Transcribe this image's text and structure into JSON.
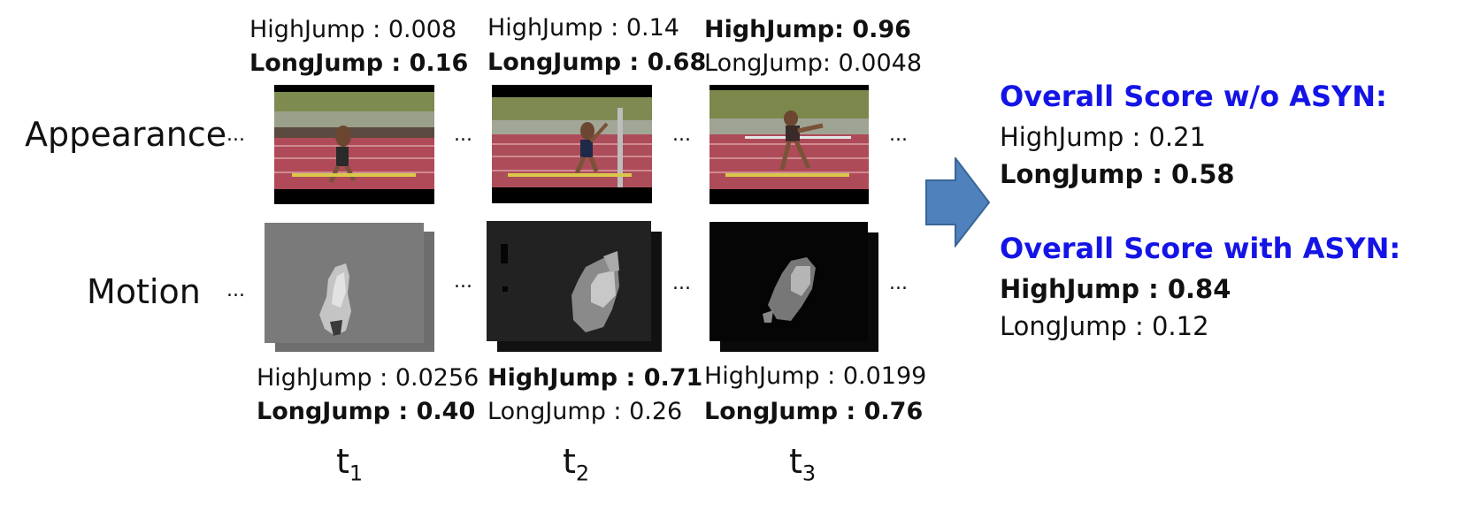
{
  "row_labels": {
    "appearance": "Appearance",
    "motion": "Motion"
  },
  "ellipsis": "...",
  "frames": [
    {
      "time_label": "t",
      "time_sub": "1",
      "appearance_scores": [
        {
          "text": "HighJump : 0.008",
          "bold": false
        },
        {
          "text": "LongJump : 0.16",
          "bold": true
        }
      ],
      "motion_scores": [
        {
          "text": "HighJump : 0.0256",
          "bold": false
        },
        {
          "text": "LongJump : 0.40",
          "bold": true
        }
      ]
    },
    {
      "time_label": "t",
      "time_sub": "2",
      "appearance_scores": [
        {
          "text": "HighJump : 0.14",
          "bold": false
        },
        {
          "text": "LongJump : 0.68",
          "bold": true
        }
      ],
      "motion_scores": [
        {
          "text": "HighJump : 0.71",
          "bold": true
        },
        {
          "text": "LongJump : 0.26",
          "bold": false
        }
      ]
    },
    {
      "time_label": "t",
      "time_sub": "3",
      "appearance_scores": [
        {
          "text": "HighJump: 0.96",
          "bold": true
        },
        {
          "text": "LongJump: 0.0048",
          "bold": false
        }
      ],
      "motion_scores": [
        {
          "text": "HighJump : 0.0199",
          "bold": false
        },
        {
          "text": "LongJump : 0.76",
          "bold": true
        }
      ]
    }
  ],
  "overall_without": {
    "title": "Overall Score w/o ASYN:",
    "lines": [
      {
        "text": "HighJump : 0.21",
        "bold": false
      },
      {
        "text": "LongJump :  0.58",
        "bold": true
      }
    ]
  },
  "overall_with": {
    "title": "Overall Score with ASYN:",
    "lines": [
      {
        "text": "HighJump : 0.84",
        "bold": true
      },
      {
        "text": "LongJump :  0.12",
        "bold": false
      }
    ]
  },
  "colors": {
    "title_blue": "#1414e6",
    "arrow_fill": "#4f81bd",
    "arrow_stroke": "#3a6596",
    "track": "#b04a58"
  }
}
